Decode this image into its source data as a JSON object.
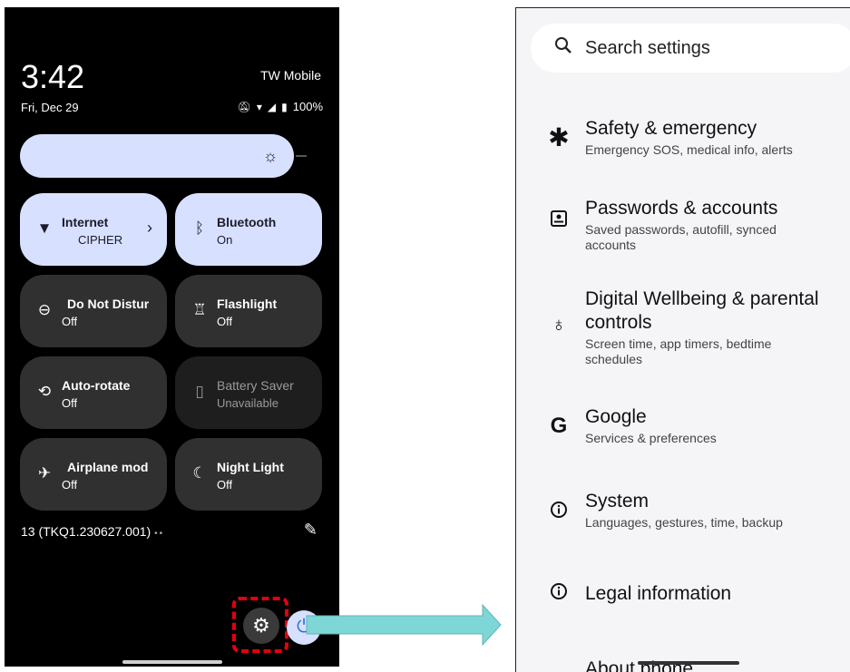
{
  "quick_settings": {
    "time": "3:42",
    "carrier": "TW Mobile",
    "date": "Fri, Dec 29",
    "battery": "100%",
    "tiles": [
      {
        "title": "Internet",
        "sub": "CIPHER",
        "state": "on"
      },
      {
        "title": "Bluetooth",
        "sub": "On",
        "state": "on"
      },
      {
        "title": "Do Not Distur",
        "sub": "Off",
        "state": "off"
      },
      {
        "title": "Flashlight",
        "sub": "Off",
        "state": "off"
      },
      {
        "title": "Auto-rotate",
        "sub": "Off",
        "state": "off"
      },
      {
        "title": "Battery Saver",
        "sub": "Unavailable",
        "state": "unavailable"
      },
      {
        "title": "Airplane mod",
        "sub": "Off",
        "state": "off"
      },
      {
        "title": "Night Light",
        "sub": "Off",
        "state": "off"
      }
    ],
    "build_number": "13 (TKQ1.230627.001)",
    "page_dots": "••"
  },
  "settings": {
    "search_placeholder": "Search settings",
    "items": [
      {
        "title": "Safety & emergency",
        "sub": "Emergency SOS, medical info, alerts",
        "icon": "asterisk-icon"
      },
      {
        "title": "Passwords & accounts",
        "sub": "Saved passwords, autofill, synced accounts",
        "icon": "account-box-icon"
      },
      {
        "title": "Digital Wellbeing & parental controls",
        "sub": "Screen time, app timers, bedtime schedules",
        "icon": "wellbeing-icon"
      },
      {
        "title": "Google",
        "sub": "Services & preferences",
        "icon": "google-icon"
      },
      {
        "title": "System",
        "sub": "Languages, gestures, time, backup",
        "icon": "info-icon"
      },
      {
        "title": "Legal information",
        "sub": "",
        "icon": "info-icon"
      },
      {
        "title": "About phone",
        "sub": "",
        "icon": "phone-icon"
      }
    ]
  },
  "colors": {
    "tile_on": "#d8e0ff",
    "tile_off": "#303030",
    "highlight": "#e3000f",
    "arrow": "#7fd6d6"
  }
}
